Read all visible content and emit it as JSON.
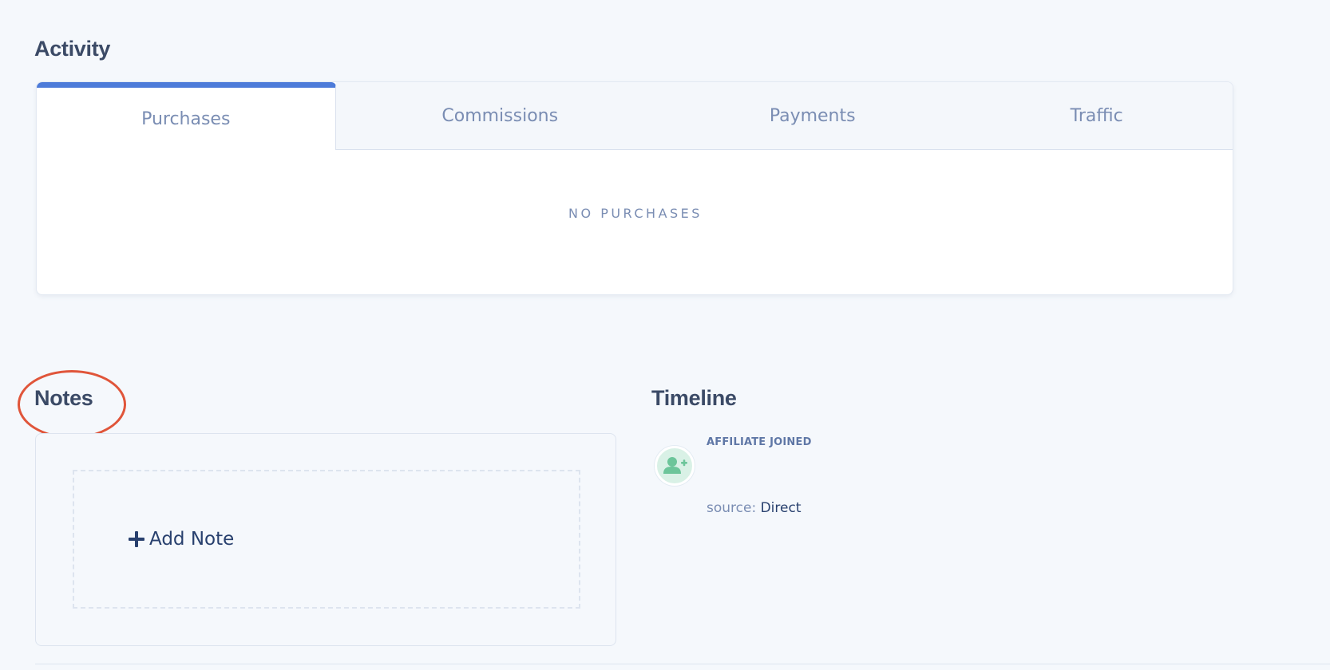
{
  "activity": {
    "title": "Activity",
    "tabs": [
      {
        "label": "Purchases",
        "active": true
      },
      {
        "label": "Commissions",
        "active": false
      },
      {
        "label": "Payments",
        "active": false
      },
      {
        "label": "Traffic",
        "active": false
      }
    ],
    "empty_message": "NO PURCHASES"
  },
  "notes": {
    "title": "Notes",
    "add_label": "Add Note",
    "add_icon": "plus-icon"
  },
  "timeline": {
    "title": "Timeline",
    "events": [
      {
        "icon": "user-plus-icon",
        "label": "AFFILIATE JOINED",
        "source_label": "source:",
        "source_value": "Direct"
      }
    ]
  },
  "colors": {
    "accent": "#4d7bd9",
    "highlight_ring": "#e0553a",
    "timeline_icon_bg": "#d9f1e6",
    "timeline_icon_fg": "#6cc59a",
    "heading": "#3b4a66",
    "muted": "#7a8db3",
    "link": "#28406e"
  }
}
